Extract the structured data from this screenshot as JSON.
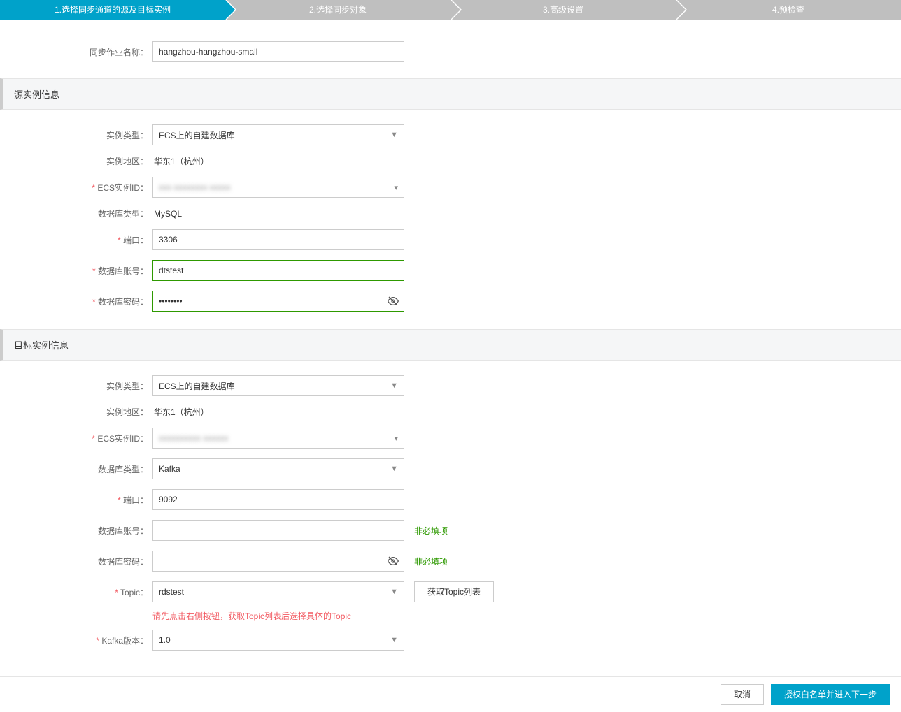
{
  "steps": {
    "s1": "1.选择同步通道的源及目标实例",
    "s2": "2.选择同步对象",
    "s3": "3.高级设置",
    "s4": "4.预检查"
  },
  "jobName": {
    "label": "同步作业名称：",
    "value": "hangzhou-hangzhou-small"
  },
  "source": {
    "title": "源实例信息",
    "instanceType": {
      "label": "实例类型：",
      "value": "ECS上的自建数据库"
    },
    "region": {
      "label": "实例地区：",
      "value": "华东1（杭州）"
    },
    "ecsId": {
      "label": "ECS实例ID：",
      "value": "xxx xxxxxxxx xxxxx"
    },
    "dbType": {
      "label": "数据库类型：",
      "value": "MySQL"
    },
    "port": {
      "label": "端口：",
      "value": "3306"
    },
    "account": {
      "label": "数据库账号：",
      "value": "dtstest"
    },
    "password": {
      "label": "数据库密码：",
      "value": "••••••••"
    }
  },
  "target": {
    "title": "目标实例信息",
    "instanceType": {
      "label": "实例类型：",
      "value": "ECS上的自建数据库"
    },
    "region": {
      "label": "实例地区：",
      "value": "华东1（杭州）"
    },
    "ecsId": {
      "label": "ECS实例ID：",
      "value": "xxxxxxxxxx xxxxxx"
    },
    "dbType": {
      "label": "数据库类型：",
      "value": "Kafka"
    },
    "port": {
      "label": "端口：",
      "value": "9092"
    },
    "account": {
      "label": "数据库账号：",
      "value": "",
      "hint": "非必填项"
    },
    "password": {
      "label": "数据库密码：",
      "value": "",
      "hint": "非必填项"
    },
    "topic": {
      "label": "Topic：",
      "value": "rdstest",
      "btn": "获取Topic列表",
      "hint": "请先点击右侧按钮，获取Topic列表后选择具体的Topic"
    },
    "kafkaVer": {
      "label": "Kafka版本：",
      "value": "1.0"
    }
  },
  "footer": {
    "cancel": "取消",
    "next": "授权白名单并进入下一步"
  }
}
